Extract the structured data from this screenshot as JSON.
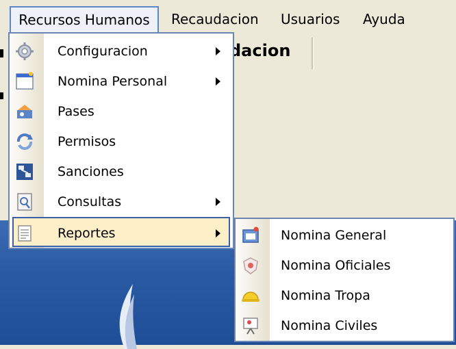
{
  "menubar": {
    "items": [
      {
        "label": "Recursos Humanos"
      },
      {
        "label": "Recaudacion"
      },
      {
        "label": "Usuarios"
      },
      {
        "label": "Ayuda"
      }
    ]
  },
  "window": {
    "toolbar_title": "dacion"
  },
  "dropdown": {
    "items": [
      {
        "label": "Configuracion",
        "icon": "gear-icon",
        "submenu": true
      },
      {
        "label": "Nomina Personal",
        "icon": "form-icon",
        "submenu": true
      },
      {
        "label": "Pases",
        "icon": "transfer-icon",
        "submenu": false
      },
      {
        "label": "Permisos",
        "icon": "refresh-icon",
        "submenu": false
      },
      {
        "label": "Sanciones",
        "icon": "network-icon",
        "submenu": false
      },
      {
        "label": "Consultas",
        "icon": "search-document-icon",
        "submenu": true
      },
      {
        "label": "Reportes",
        "icon": "report-icon",
        "submenu": true
      }
    ]
  },
  "submenu": {
    "items": [
      {
        "label": "Nomina General",
        "icon": "id-card-icon"
      },
      {
        "label": "Nomina Oficiales",
        "icon": "badge-icon"
      },
      {
        "label": "Nomina Tropa",
        "icon": "helmet-icon"
      },
      {
        "label": "Nomina Civiles",
        "icon": "presentation-icon"
      }
    ]
  },
  "colors": {
    "menu_border": "#6b86b5",
    "highlight_bg": "#fdf0c8",
    "highlight_border": "#3d5fa6",
    "desktop_blue": "#2b5aa4"
  }
}
